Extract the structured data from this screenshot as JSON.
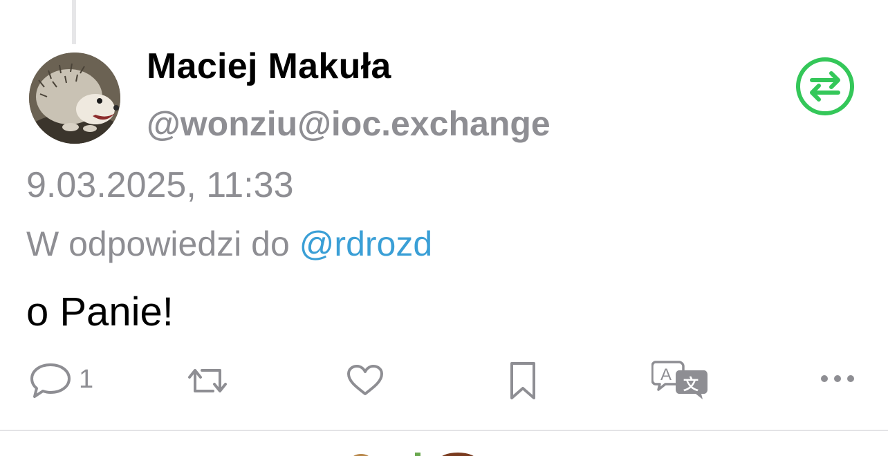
{
  "post": {
    "author": {
      "display_name": "Maciej Makuła",
      "handle": "@wonziu@ioc.exchange",
      "avatar_icon": "hedgehog-avatar"
    },
    "timestamp": "9.03.2025, 11:33",
    "reply_prefix": "W odpowiedzi do ",
    "reply_mention": "@rdrozd",
    "content": "o Panie!",
    "actions": {
      "reply_icon": "speech-bubble-icon",
      "reply_count": "1",
      "boost_icon": "repeat-icon",
      "favourite_icon": "heart-icon",
      "bookmark_icon": "bookmark-icon",
      "translate_icon": "translate-icon",
      "more_icon": "ellipsis-icon"
    },
    "badge_icon": "swap-arrows-icon"
  },
  "colors": {
    "accent_green": "#34c759",
    "mention_blue": "#3a9fd6",
    "secondary_gray": "#8e8e93"
  }
}
